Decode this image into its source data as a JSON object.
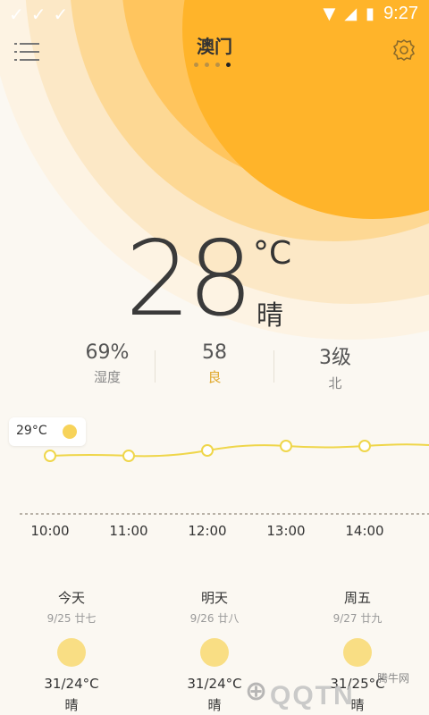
{
  "status_bar": {
    "time": "9:27"
  },
  "header": {
    "city": "澳门",
    "pages": 4,
    "active_page": 4
  },
  "current": {
    "temperature": "28",
    "unit": "°C",
    "condition": "晴",
    "humidity_value": "69%",
    "humidity_label": "湿度",
    "aqi_value": "58",
    "aqi_label": "良",
    "wind_value": "3级",
    "wind_label": "北"
  },
  "hourly": {
    "tooltip_temp": "29°C",
    "hours": [
      {
        "time": "10:00"
      },
      {
        "time": "11:00"
      },
      {
        "time": "12:00"
      },
      {
        "time": "13:00"
      },
      {
        "time": "14:00"
      }
    ]
  },
  "daily": [
    {
      "name": "今天",
      "date": "9/25 廿七",
      "temps": "31/24°C",
      "condition": "晴"
    },
    {
      "name": "明天",
      "date": "9/26 廿八",
      "temps": "31/24°C",
      "condition": "晴"
    },
    {
      "name": "周五",
      "date": "9/27 廿九",
      "temps": "31/25°C",
      "condition": "晴"
    }
  ],
  "watermark": {
    "text": "QQTN",
    "site": "腾牛网"
  },
  "colors": {
    "sun": "#ffb42a",
    "accent": "#e0a82a",
    "line": "#efd64a"
  }
}
